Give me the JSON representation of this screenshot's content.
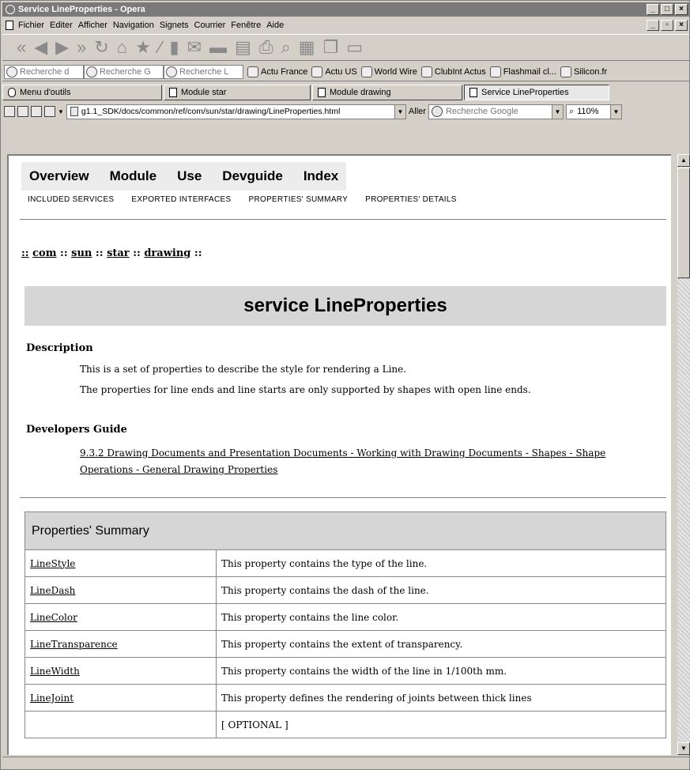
{
  "window": {
    "title": "Service LineProperties - Opera"
  },
  "menu": [
    "Fichier",
    "Editer",
    "Afficher",
    "Navigation",
    "Signets",
    "Courrier",
    "Fenêtre",
    "Aide"
  ],
  "bookmarks": [
    {
      "label": "Recherche d",
      "kind": "search"
    },
    {
      "label": "Recherche G",
      "kind": "search"
    },
    {
      "label": "Recherche L",
      "kind": "search"
    },
    {
      "label": "Actu France",
      "kind": "page"
    },
    {
      "label": "Actu US",
      "kind": "page"
    },
    {
      "label": "World Wire",
      "kind": "page"
    },
    {
      "label": "ClubInt Actus",
      "kind": "page"
    },
    {
      "label": "Flashmail cl...",
      "kind": "page"
    },
    {
      "label": "Silicon.fr",
      "kind": "page"
    }
  ],
  "tabs": [
    {
      "label": "Menu d'outils",
      "active": false
    },
    {
      "label": "Module star",
      "active": false
    },
    {
      "label": "Module drawing",
      "active": false
    },
    {
      "label": "Service LineProperties",
      "active": true
    }
  ],
  "address": {
    "url": "g1.1_SDK/docs/common/ref/com/sun/star/drawing/LineProperties.html",
    "go_label": "Aller",
    "search_placeholder": "Recherche Google",
    "zoom": "110%"
  },
  "page": {
    "nav_top": [
      "Overview",
      "Module",
      "Use",
      "Devguide",
      "Index"
    ],
    "nav_sub": [
      "Included Services",
      "Exported Interfaces",
      "Properties' Summary",
      "Properties' Details"
    ],
    "breadcrumb": {
      "sep": "::",
      "items": [
        "com",
        "sun",
        "star",
        "drawing"
      ]
    },
    "title": "service LineProperties",
    "description": {
      "heading": "Description",
      "lines": [
        "This is a set of properties to describe the style for rendering a Line.",
        "The properties for line ends and line starts are only supported by shapes with open line ends."
      ]
    },
    "devguide": {
      "heading": "Developers Guide",
      "link": "9.3.2 Drawing Documents and Presentation Documents - Working with Drawing Documents - Shapes - Shape Operations - General Drawing Properties"
    },
    "summary": {
      "heading": "Properties' Summary",
      "rows": [
        {
          "name": "LineStyle",
          "desc": "This property contains the type of the line."
        },
        {
          "name": "LineDash",
          "desc": "This property contains the dash of the line."
        },
        {
          "name": "LineColor",
          "desc": "This property contains the line color."
        },
        {
          "name": "LineTransparence",
          "desc": "This property contains the extent of transparency."
        },
        {
          "name": "LineWidth",
          "desc": "This property contains the width of the line in 1/100th mm."
        },
        {
          "name": "LineJoint",
          "desc": "This property defines the rendering of joints between thick lines"
        },
        {
          "name": "",
          "desc": "[ OPTIONAL ]"
        }
      ]
    }
  }
}
